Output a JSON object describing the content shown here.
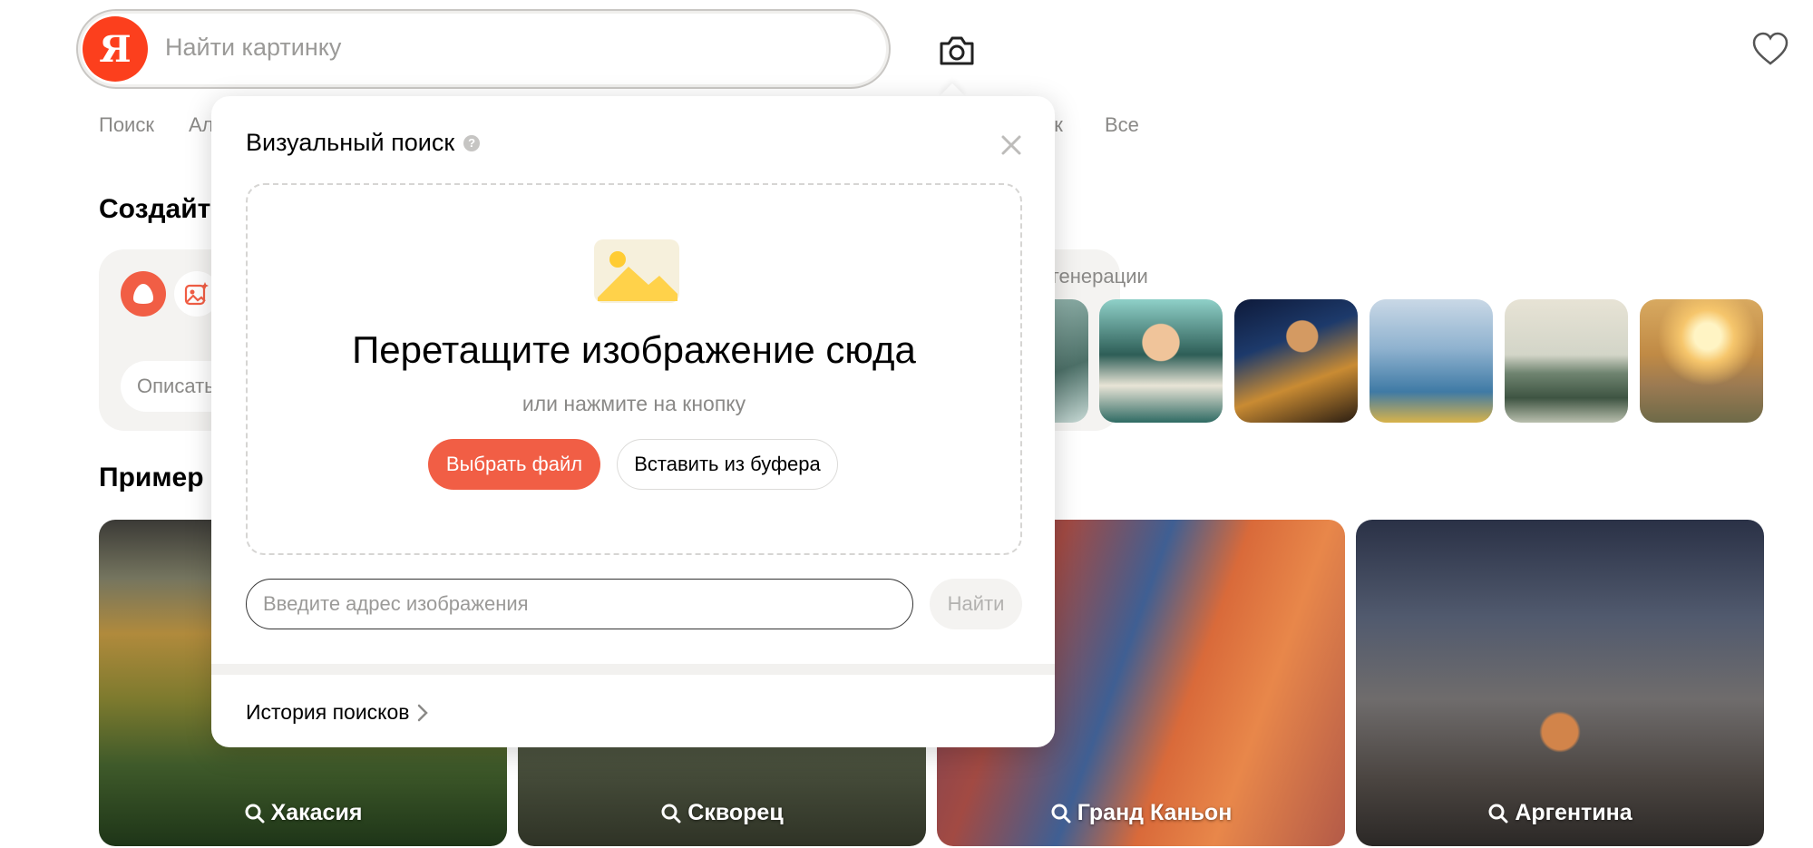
{
  "header": {
    "logo_letter": "Я",
    "search_placeholder": "Найти картинку",
    "camera_icon": "camera-icon",
    "favorites_icon": "heart-icon"
  },
  "tabs": [
    {
      "label": "Поиск"
    },
    {
      "label": "Ал"
    },
    {
      "label": "ик"
    },
    {
      "label": "Все"
    }
  ],
  "create_section": {
    "title": "Создайт",
    "describe_placeholder": "Описать",
    "generations_label": "генерации"
  },
  "examples_section": {
    "title": "Пример",
    "items": [
      {
        "label": "Хакасия"
      },
      {
        "label": "Скворец"
      },
      {
        "label": "Гранд Каньон"
      },
      {
        "label": "Аргентина"
      }
    ]
  },
  "modal": {
    "title": "Визуальный поиск",
    "help_mark": "?",
    "dropzone_title": "Перетащите изображение сюда",
    "dropzone_subtitle": "или нажмите на кнопку",
    "choose_file_label": "Выбрать файл",
    "paste_label": "Вставить из буфера",
    "url_placeholder": "Введите адрес изображения",
    "find_label": "Найти",
    "history_label": "История поисков"
  },
  "colors": {
    "brand": "#fc3f1d",
    "accent_button": "#f15e45",
    "muted_text": "#8a8987",
    "surface": "#f4f3f1"
  }
}
